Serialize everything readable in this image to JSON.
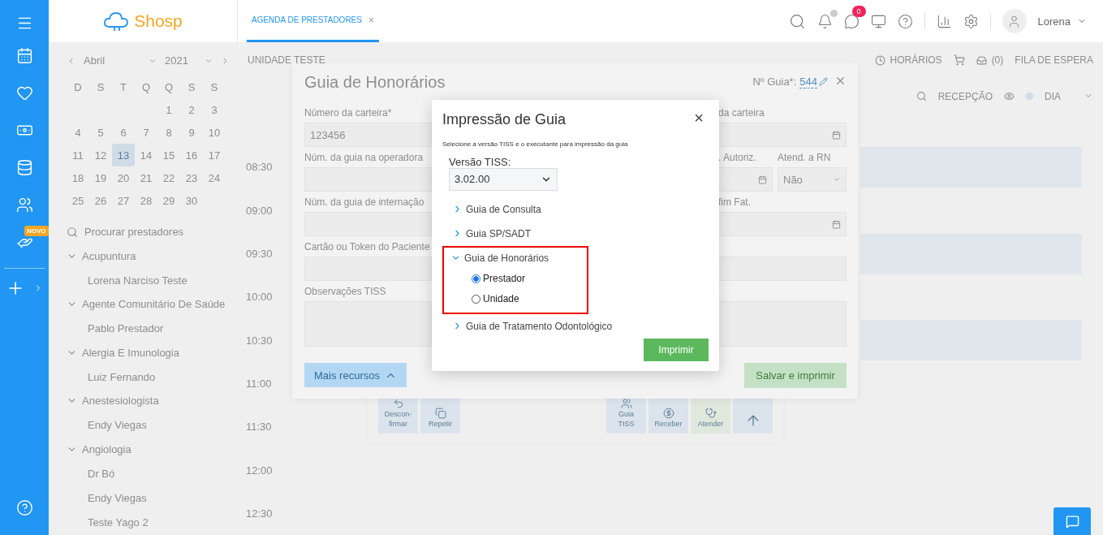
{
  "sidebar": [
    {
      "kind": "menu"
    },
    {
      "kind": "calendar"
    },
    {
      "kind": "heart"
    },
    {
      "kind": "money"
    },
    {
      "kind": "database"
    },
    {
      "kind": "people"
    },
    {
      "kind": "support",
      "badge": "NOVO"
    },
    {
      "kind": "add"
    },
    {
      "kind": "help"
    }
  ],
  "header": {
    "logo": "Shosp",
    "tabs": [
      {
        "label": "AGENDA DE PRESTADORES",
        "close": "×",
        "selected": true
      }
    ],
    "actions": [
      {
        "kind": "search"
      },
      {
        "kind": "bell"
      },
      {
        "kind": "chat",
        "badge": "0"
      },
      {
        "kind": "monitor"
      },
      {
        "kind": "help"
      },
      {
        "kind": "reports"
      },
      {
        "kind": "settings"
      }
    ],
    "user": {
      "name": "Lorena"
    }
  },
  "calendar": {
    "month": "Abril",
    "year": "2021",
    "weekdays": [
      "D",
      "S",
      "T",
      "Q",
      "Q",
      "S",
      "S"
    ],
    "weeks": [
      [
        {
          "day": "1",
          "selected": false
        },
        {
          "day": "2",
          "selected": false
        },
        {
          "day": "3",
          "selected": false
        }
      ],
      [
        {
          "day": "4",
          "selected": false
        },
        {
          "day": "5",
          "selected": false
        },
        {
          "day": "6",
          "selected": false
        },
        {
          "day": "7",
          "selected": false
        },
        {
          "day": "8",
          "selected": false
        },
        {
          "day": "9",
          "selected": false
        },
        {
          "day": "10",
          "selected": false
        }
      ],
      [
        {
          "day": "11",
          "selected": false
        },
        {
          "day": "12",
          "selected": false
        },
        {
          "day": "13",
          "selected": true
        },
        {
          "day": "14",
          "selected": false
        },
        {
          "day": "15",
          "selected": false
        },
        {
          "day": "16",
          "selected": false
        },
        {
          "day": "17",
          "selected": false
        }
      ],
      [
        {
          "day": "18",
          "selected": false
        },
        {
          "day": "19",
          "selected": false
        },
        {
          "day": "20",
          "selected": false
        },
        {
          "day": "21",
          "selected": false
        },
        {
          "day": "22",
          "selected": false
        },
        {
          "day": "23",
          "selected": false
        },
        {
          "day": "24",
          "selected": false
        }
      ],
      [
        {
          "day": "25",
          "selected": false
        },
        {
          "day": "26",
          "selected": false
        },
        {
          "day": "27",
          "selected": false
        },
        {
          "day": "28",
          "selected": false
        },
        {
          "day": "29",
          "selected": false
        },
        {
          "day": "30",
          "selected": false
        }
      ]
    ]
  },
  "provider_search": {
    "placeholder": "Procurar prestadores"
  },
  "specialties": [
    {
      "name": "Acupuntura",
      "expanded": true,
      "children": [
        {
          "name": "Lorena Narciso Teste"
        }
      ]
    },
    {
      "name": "Agente Comunitário De Saúde",
      "expanded": true,
      "children": [
        {
          "name": "Pablo Prestador"
        }
      ]
    },
    {
      "name": "Alergia E Imunologia",
      "expanded": true,
      "children": [
        {
          "name": "Luiz Fernando"
        }
      ]
    },
    {
      "name": "Anestesiologista",
      "expanded": true,
      "children": [
        {
          "name": "Endy Viegas"
        }
      ]
    },
    {
      "name": "Angiologia",
      "expanded": true,
      "children": [
        {
          "name": "Dr Bó"
        },
        {
          "name": "Endy Viegas"
        },
        {
          "name": "Teste Yago 2"
        }
      ]
    }
  ],
  "schedule": {
    "unit": "UNIDADE TESTE",
    "hours_button": "HORÁRIOS",
    "waiting_count": "(0)",
    "waiting_list": "FILA DE ESPERA",
    "room": "RECEPÇÃO",
    "view": "DIA",
    "slots": [
      {
        "time": "08:30",
        "appointment": true
      },
      {
        "time": "09:00",
        "appointment": false
      },
      {
        "time": "09:30",
        "appointment": true
      },
      {
        "time": "10:00",
        "appointment": false
      },
      {
        "time": "10:30",
        "appointment": true
      },
      {
        "time": "11:00",
        "appointment": false
      },
      {
        "time": "11:30",
        "appointment": false
      },
      {
        "time": "12:00",
        "appointment": false
      },
      {
        "time": "12:30",
        "appointment": false
      }
    ],
    "actions": [
      {
        "kind": "unconfirm",
        "label": "Descon-firmar"
      },
      {
        "kind": "repeat",
        "label": "Repetir"
      },
      {
        "kind": "tiss",
        "label": "Guia TISS"
      },
      {
        "kind": "receive",
        "label": "Receber"
      },
      {
        "kind": "attend",
        "label": "Atender"
      },
      {
        "kind": "up"
      }
    ]
  },
  "guide_dialog": {
    "title": "Guia de Honorários",
    "number_label": "Nº Guia*:",
    "number": "544",
    "left_fields": [
      {
        "label": "Número da carteira*",
        "value": "123456",
        "kind": "input"
      },
      {
        "label": "Núm. da guia na operadora",
        "kind": "input"
      },
      {
        "label": "Núm. da guia de internação",
        "kind": "input"
      },
      {
        "label": "Cartão ou Token do Paciente",
        "kind": "input"
      },
      {
        "label": "Observações TISS",
        "kind": "textarea"
      }
    ],
    "right_fields": [
      {
        "kind": "date",
        "label": "da carteira"
      },
      {
        "kind": "pair",
        "label": ". Autoriz.",
        "label_2": "Atend. a RN",
        "value_2": "Não"
      },
      {
        "kind": "date",
        "label": "fim Fat."
      },
      {
        "kind": "input"
      },
      {
        "kind": "textarea"
      }
    ],
    "more_button": "Mais recursos",
    "save_button": "Salvar e imprimir"
  },
  "print_dialog": {
    "title": "Impressão de Guia",
    "close": "×",
    "subtitle": "Selecione a versão TISS e o executante para impressão da guia",
    "version_label": "Versão TISS:",
    "version": "3.02.00",
    "guides": [
      {
        "label": "Guia de Consulta",
        "expanded": false,
        "highlighted": false
      },
      {
        "label": "Guia SP/SADT",
        "expanded": false,
        "highlighted": false
      },
      {
        "label": "Guia de Honorários",
        "expanded": true,
        "highlighted": true,
        "options": [
          {
            "label": "Prestador",
            "selected": true
          },
          {
            "label": "Unidade",
            "selected": false
          }
        ]
      },
      {
        "label": "Guia de Tratamento Odontológico",
        "expanded": false,
        "highlighted": false
      }
    ],
    "print_button": "Imprimir"
  }
}
